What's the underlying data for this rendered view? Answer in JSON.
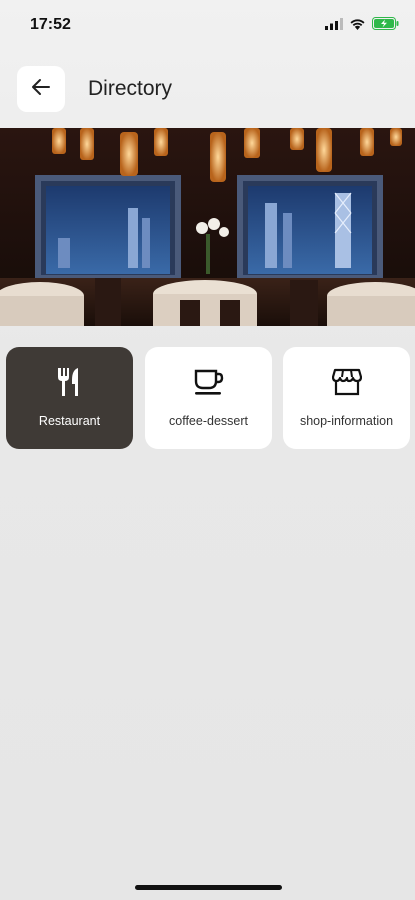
{
  "status_bar": {
    "time": "17:52",
    "icons": [
      "signal-icon",
      "wifi-icon",
      "battery-charging-icon"
    ]
  },
  "header": {
    "back_icon": "arrow-left-icon",
    "title": "Directory"
  },
  "hero": {
    "image": "restaurant-dining-room-photo"
  },
  "categories": [
    {
      "label": "Restaurant",
      "icon": "fork-knife-icon",
      "selected": true
    },
    {
      "label": "coffee-dessert",
      "icon": "coffee-cup-icon",
      "selected": false
    },
    {
      "label": "shop-information",
      "icon": "storefront-icon",
      "selected": false
    }
  ],
  "colors": {
    "active_card": "#3f3a36",
    "card": "#ffffff",
    "background": "#e8e8e8"
  }
}
